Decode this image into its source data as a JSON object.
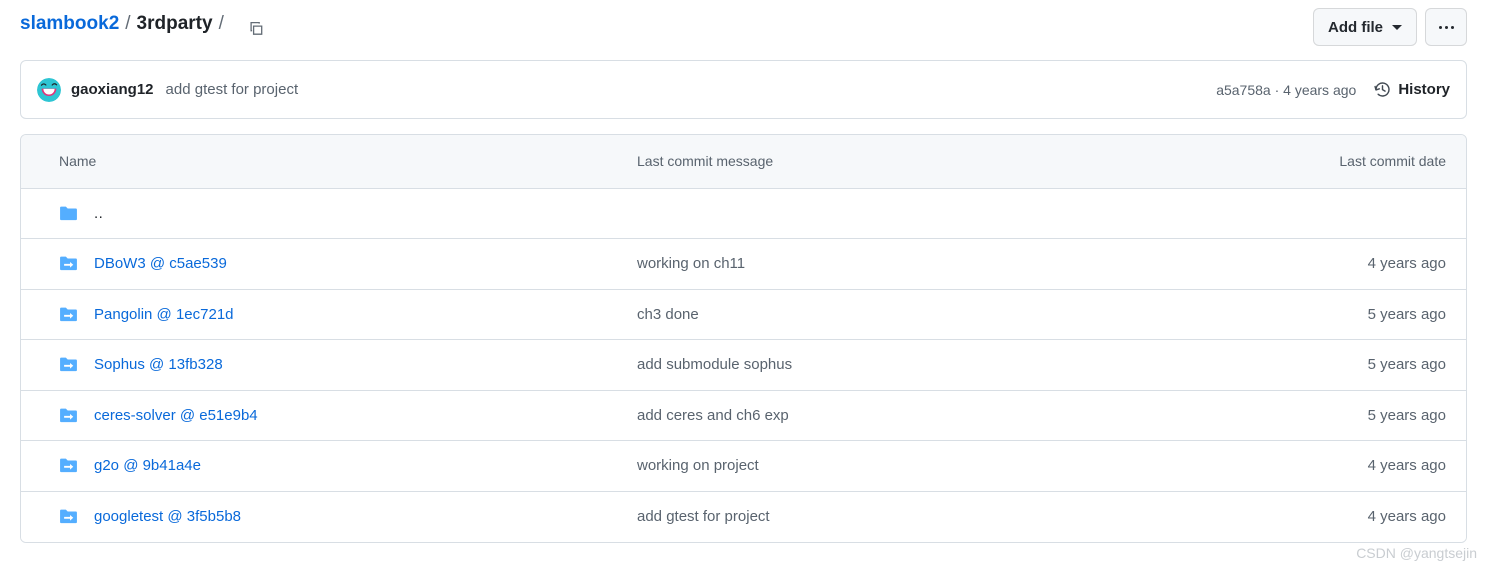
{
  "breadcrumb": {
    "repo": "slambook2",
    "path": "3rdparty",
    "separator": "/",
    "copy_icon": "copy-icon"
  },
  "top_actions": {
    "add_file_label": "Add file",
    "overflow_label": "•••"
  },
  "latest_commit": {
    "author": "gaoxiang12",
    "message": "add gtest for project",
    "meta": "a5a758a · 4 years ago",
    "history_label": "History",
    "history_icon": "history-clock-icon",
    "avatar_icon": "user-avatar"
  },
  "file_table": {
    "columns": {
      "name": "Name",
      "message": "Last commit message",
      "date": "Last commit date"
    },
    "rows": [
      {
        "icon": "folder-icon",
        "name": "..",
        "is_link": false,
        "message": "",
        "date": ""
      },
      {
        "icon": "submodule-icon",
        "name": "DBoW3 @ c5ae539",
        "is_link": true,
        "message": "working on ch11",
        "date": "4 years ago"
      },
      {
        "icon": "submodule-icon",
        "name": "Pangolin @ 1ec721d",
        "is_link": true,
        "message": "ch3 done",
        "date": "5 years ago"
      },
      {
        "icon": "submodule-icon",
        "name": "Sophus @ 13fb328",
        "is_link": true,
        "message": "add submodule sophus",
        "date": "5 years ago"
      },
      {
        "icon": "submodule-icon",
        "name": "ceres-solver @ e51e9b4",
        "is_link": true,
        "message": "add ceres and ch6 exp",
        "date": "5 years ago"
      },
      {
        "icon": "submodule-icon",
        "name": "g2o @ 9b41a4e",
        "is_link": true,
        "message": "working on project",
        "date": "4 years ago"
      },
      {
        "icon": "submodule-icon",
        "name": "googletest @ 3f5b5b8",
        "is_link": true,
        "message": "add gtest for project",
        "date": "4 years ago"
      }
    ]
  },
  "watermark": "CSDN @yangtsejin",
  "colors": {
    "link": "#0969da",
    "muted": "#59636e",
    "border": "#d8dee4",
    "header_bg": "#f6f8fa",
    "folder_blue": "#54aeff",
    "avatar_bg": "#2ec5d3",
    "avatar_face": "#e0337a"
  }
}
